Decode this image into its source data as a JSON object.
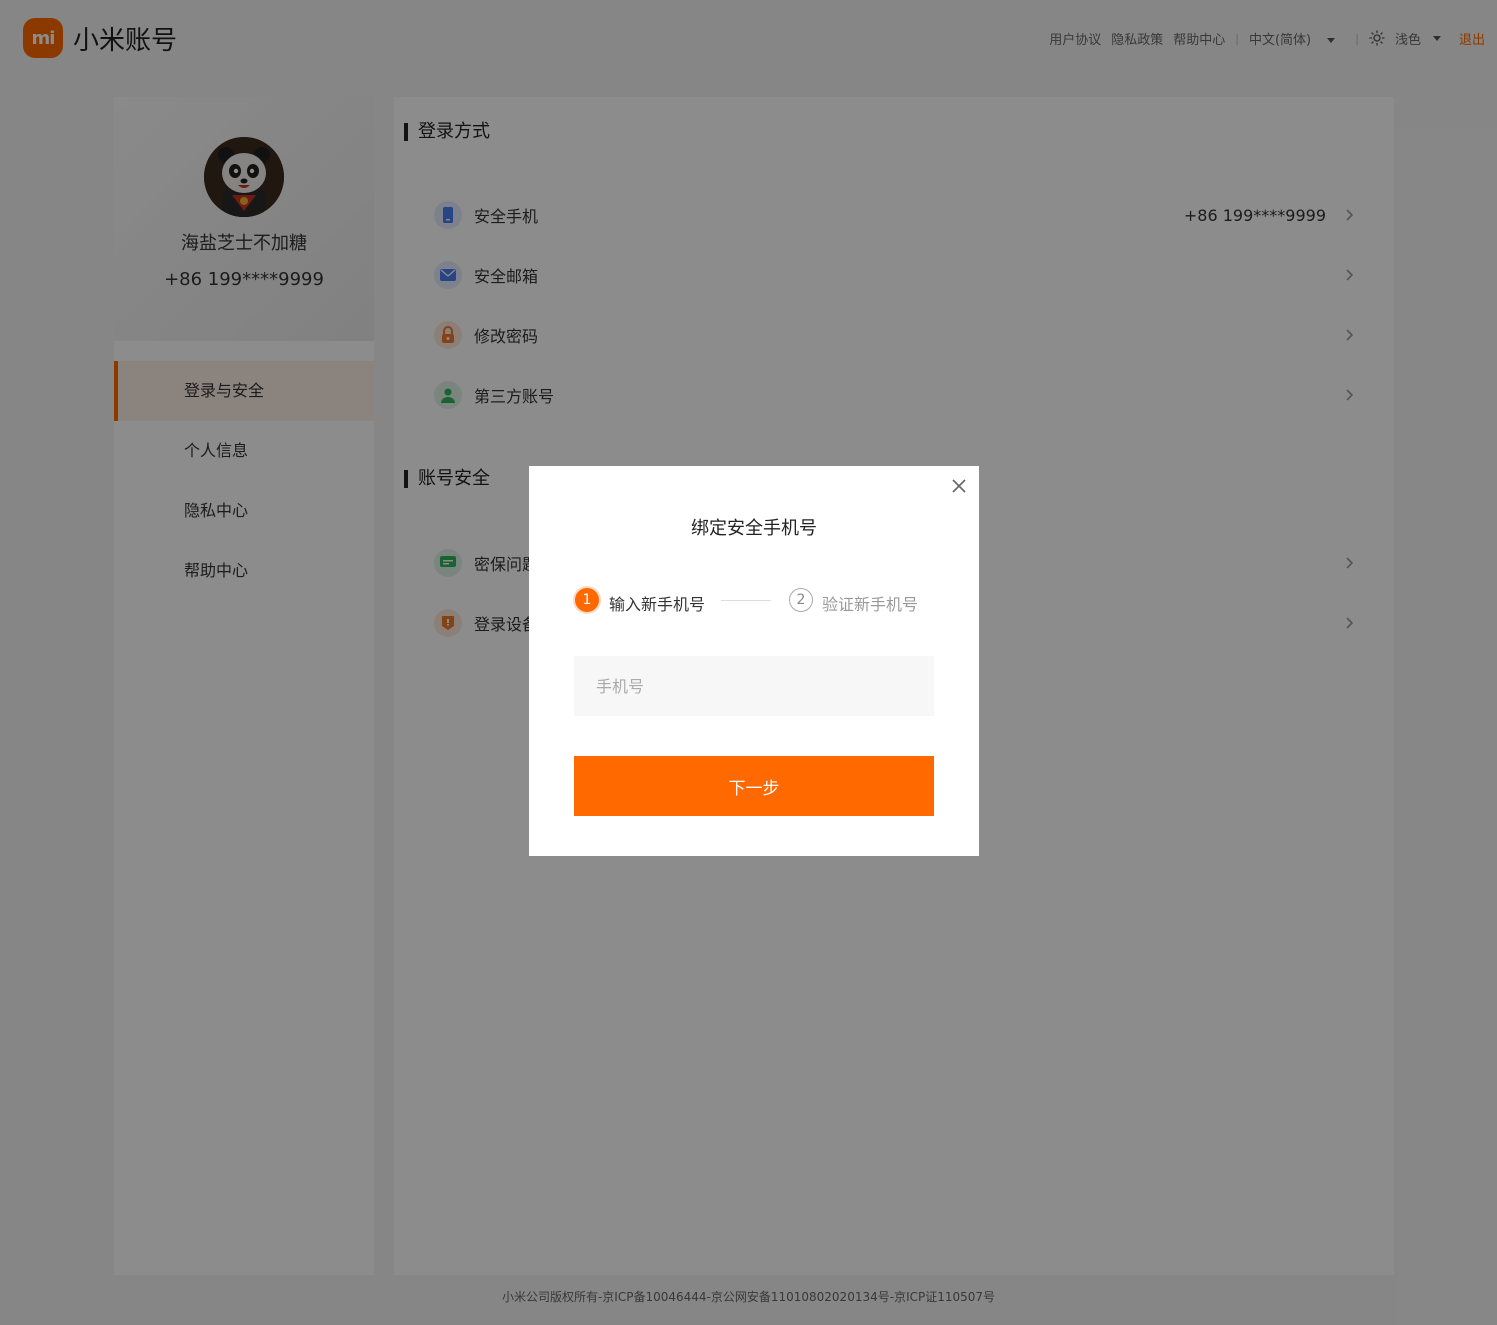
{
  "header": {
    "logo_text": "mi",
    "brand": "小米账号",
    "links": [
      "用户协议",
      "隐私政策",
      "帮助中心"
    ],
    "language": "中文(简体)",
    "theme": "浅色",
    "logout": "退出"
  },
  "profile": {
    "nickname": "海盐芝士不加糖",
    "phone": "+86 199****9999"
  },
  "sidebar": {
    "items": [
      {
        "label": "登录与安全",
        "active": true
      },
      {
        "label": "个人信息",
        "active": false
      },
      {
        "label": "隐私中心",
        "active": false
      },
      {
        "label": "帮助中心",
        "active": false
      }
    ]
  },
  "main": {
    "login_section": {
      "title": "登录方式",
      "rows": [
        {
          "label": "安全手机",
          "value": "+86 199****9999",
          "icon": "phone-icon",
          "color": "#4a7cf0"
        },
        {
          "label": "安全邮箱",
          "value": "",
          "icon": "mail-icon",
          "color": "#4a7cf0"
        },
        {
          "label": "修改密码",
          "value": "",
          "icon": "lock-icon",
          "color": "#f07a2a"
        },
        {
          "label": "第三方账号",
          "value": "",
          "icon": "user-icon",
          "color": "#2fb35a"
        }
      ]
    },
    "security_section": {
      "title": "账号安全",
      "rows": [
        {
          "label": "密保问题",
          "icon": "question-icon",
          "color": "#2fb35a"
        },
        {
          "label": "登录设备",
          "icon": "device-icon",
          "color": "#f07a2a"
        }
      ]
    }
  },
  "modal": {
    "title": "绑定安全手机号",
    "step1_num": "1",
    "step1": "输入新手机号",
    "step2_num": "2",
    "step2": "验证新手机号",
    "phone_placeholder": "手机号",
    "phone_value": "",
    "next": "下一步"
  },
  "footer": {
    "copyright": "小米公司版权所有-京ICP备10046444-京公网安备11010802020134号-京ICP证110507号"
  },
  "colors": {
    "accent": "#ff6900",
    "overlay": "rgba(0,0,0,0.45)"
  }
}
